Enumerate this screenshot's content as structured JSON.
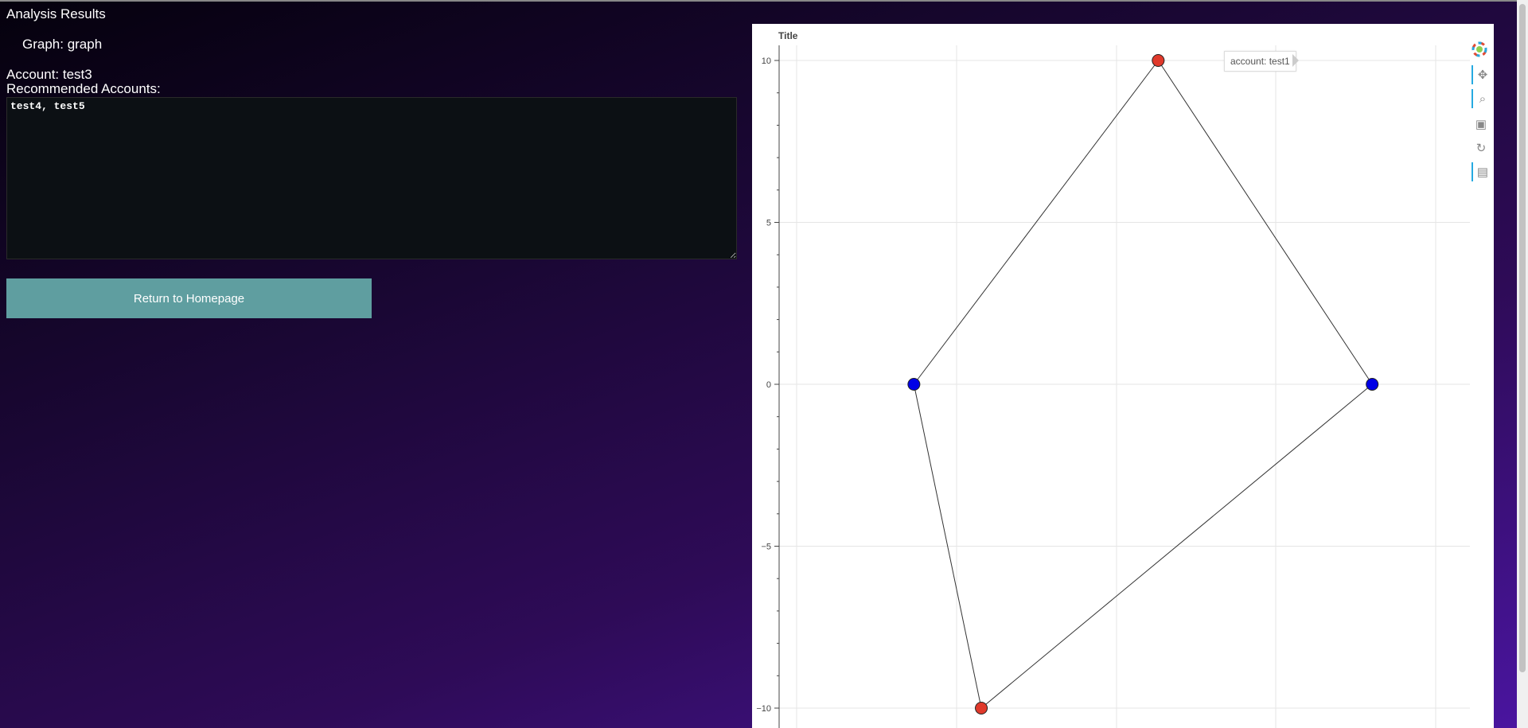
{
  "page": {
    "heading": "Analysis Results",
    "graph_label": "Graph: graph",
    "account_label": "Account: test3",
    "recommended_label": "Recommended Accounts:",
    "recommended_value": "test4, test5",
    "return_button": "Return to Homepage"
  },
  "tooltip": {
    "text": "account: test1"
  },
  "toolbar": {
    "tools": [
      "bokeh-logo-icon",
      "pan-icon",
      "wheel-zoom-icon",
      "save-icon",
      "reset-icon",
      "hover-icon"
    ]
  },
  "colors": {
    "button": "#5f9ea0",
    "node_red": "#e0392b",
    "node_blue": "#0000e6",
    "textarea_bg": "#0c1014"
  },
  "chart_data": {
    "type": "scatter",
    "title": "Title",
    "xlabel": "",
    "ylabel": "",
    "ylim": [
      -10,
      10
    ],
    "y_ticks": [
      "10",
      "5",
      "0",
      "−5",
      "−10"
    ],
    "nodes": [
      {
        "label": "test1",
        "x": 0.35,
        "y": 10,
        "color": "red"
      },
      {
        "label": "",
        "x": -1.1,
        "y": 0,
        "color": "blue"
      },
      {
        "label": "",
        "x": 1.62,
        "y": 0,
        "color": "blue"
      },
      {
        "label": "",
        "x": -0.7,
        "y": -10,
        "color": "red"
      }
    ],
    "edges": [
      [
        0,
        1
      ],
      [
        0,
        2
      ],
      [
        1,
        3
      ],
      [
        2,
        3
      ]
    ],
    "grid": true
  }
}
